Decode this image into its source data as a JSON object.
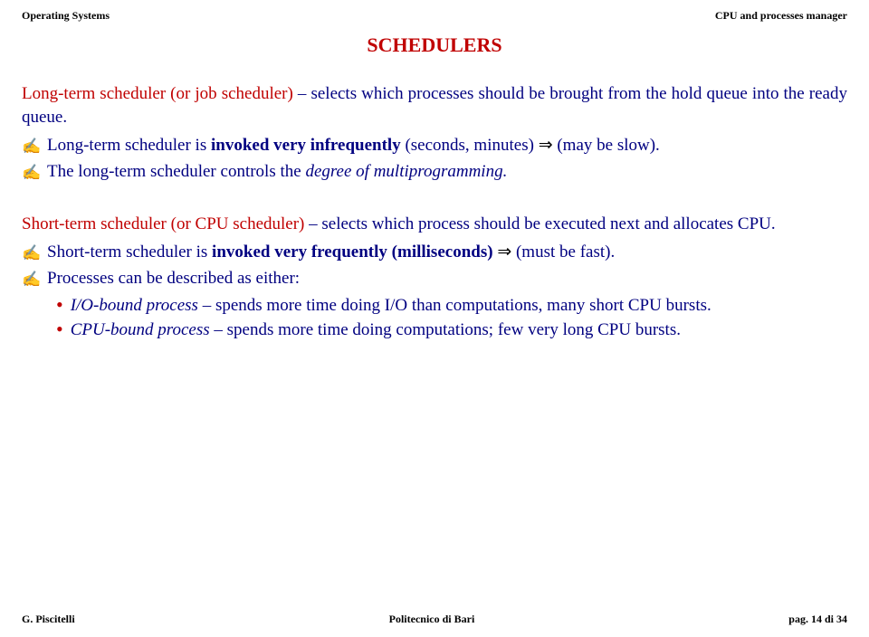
{
  "header": {
    "left": "Operating Systems",
    "right": "CPU and processes manager"
  },
  "title": "SCHEDULERS",
  "p1": {
    "lead_red": "Long-term scheduler",
    "paren_red": " (or job scheduler)",
    "rest": " – selects which processes should be brought from the hold queue into the ready queue."
  },
  "b1": {
    "pre": "Long-term scheduler is ",
    "bold": "invoked very infrequently",
    "post": " (seconds, minutes) ",
    "arrow": "⇒",
    "tail": " (may be slow)."
  },
  "b2": {
    "pre": "The long-term scheduler controls the ",
    "ital": "degree of multiprogramming.",
    "post": ""
  },
  "p2": {
    "lead_red": "Short-term scheduler",
    "paren_red": " (or CPU scheduler)",
    "rest": " – selects which process should be executed next and allocates CPU."
  },
  "b3": {
    "pre": "Short-term scheduler is ",
    "bold": "invoked very frequently (milliseconds)",
    "post": " ",
    "arrow": "⇒",
    "tail": " (must be fast)."
  },
  "b4": {
    "text": "Processes can be described as either:"
  },
  "sb1": {
    "ital": "I/O-bound process",
    "rest": " – spends more time doing I/O than computations, many short CPU bursts."
  },
  "sb2": {
    "ital": "CPU-bound process",
    "rest": " – spends more time doing computations; few very long CPU bursts."
  },
  "footer": {
    "left": "G. Piscitelli",
    "center": "Politecnico di Bari",
    "page_prefix": "pag. ",
    "page_num": "14",
    "page_of": " di ",
    "page_total": "34"
  }
}
